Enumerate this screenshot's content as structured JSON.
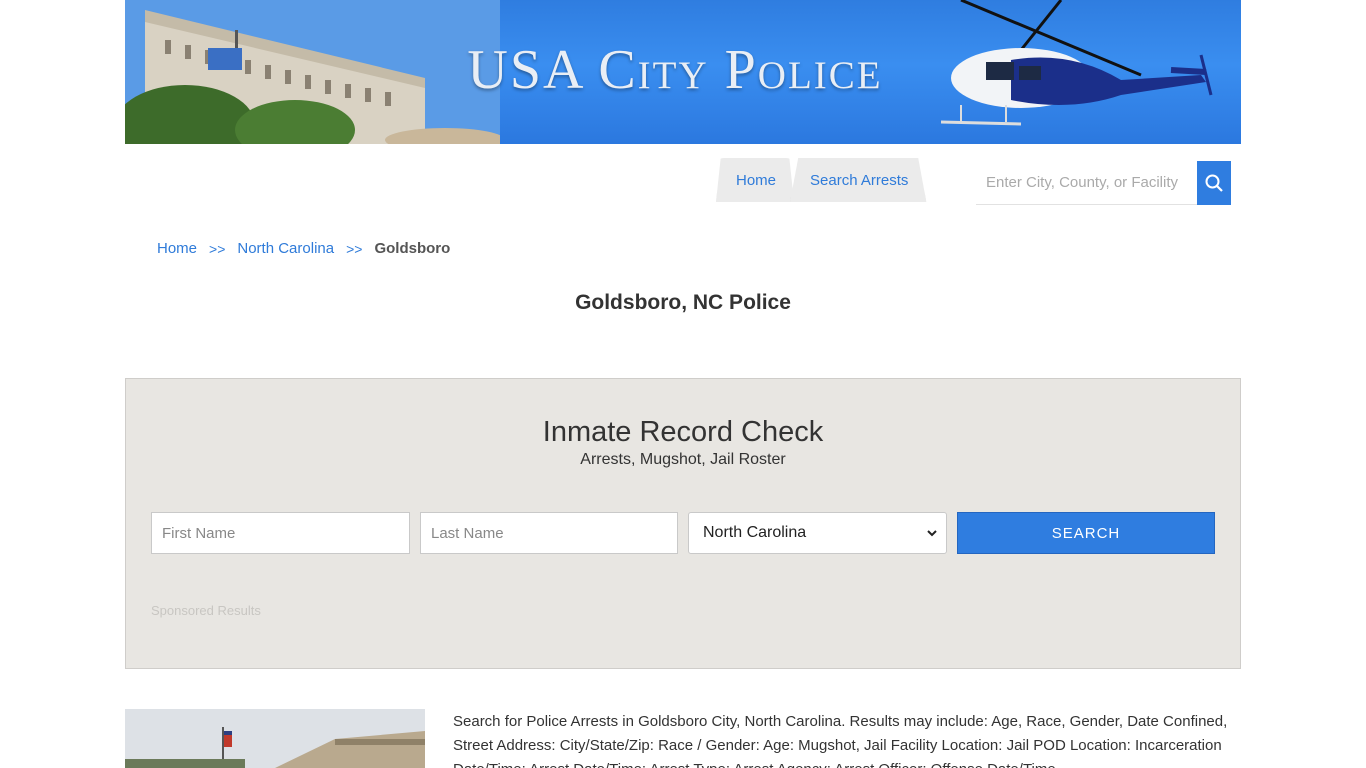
{
  "banner": {
    "title": "USA City Police"
  },
  "nav": {
    "home": "Home",
    "search_arrests": "Search Arrests"
  },
  "search": {
    "placeholder": "Enter City, County, or Facility"
  },
  "breadcrumb": {
    "home": "Home",
    "sep": ">>",
    "state": "North Carolina",
    "current": "Goldsboro"
  },
  "page": {
    "title": "Goldsboro, NC Police"
  },
  "record_check": {
    "title": "Inmate Record Check",
    "subtitle": "Arrests, Mugshot, Jail Roster",
    "first_name_placeholder": "First Name",
    "last_name_placeholder": "Last Name",
    "state_selected": "North Carolina",
    "search_label": "SEARCH",
    "sponsored": "Sponsored Results"
  },
  "content": {
    "description": "Search for Police Arrests in Goldsboro City, North Carolina. Results may include: Age, Race, Gender, Date Confined, Street Address: City/State/Zip: Race / Gender: Age: Mugshot, Jail Facility Location: Jail POD Location: Incarceration Date/Time: Arrest Date/Time: Arrest Type: Arrest Agency: Arrest Officer: Offense Date/Time"
  },
  "colors": {
    "accent": "#2f7de0",
    "link": "#2f7bd9",
    "panel_bg": "#e8e6e2"
  }
}
